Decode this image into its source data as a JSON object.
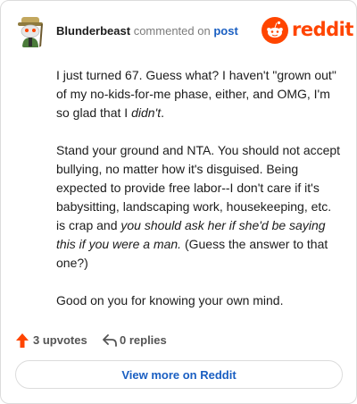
{
  "header": {
    "author": "Blunderbeast",
    "action": "commented on",
    "post_link": "post",
    "brand": "reddit"
  },
  "comment": {
    "paragraphs": [
      [
        {
          "text": "I just turned 67. Guess what? I haven't \"grown out\" of my no-kids-for-me phase, either, and OMG, I'm so glad that I ",
          "italic": false
        },
        {
          "text": "didn't",
          "italic": true
        },
        {
          "text": ".",
          "italic": false
        }
      ],
      [
        {
          "text": "Stand your ground and NTA. You should not accept bullying, no matter how it's disguised. Being expected to provide free labor--I don't care if it's babysitting, landscaping work, housekeeping, etc. is crap and ",
          "italic": false
        },
        {
          "text": "you should ask her if she'd be saying this if you were a man.",
          "italic": true
        },
        {
          "text": " (Guess the answer to that one?)",
          "italic": false
        }
      ],
      [
        {
          "text": "Good on you for knowing your own mind.",
          "italic": false
        }
      ]
    ]
  },
  "footer": {
    "upvotes": "3 upvotes",
    "replies": "0 replies",
    "upvote_color": "#ff4500"
  },
  "actions": {
    "view_more": "View more on Reddit"
  }
}
